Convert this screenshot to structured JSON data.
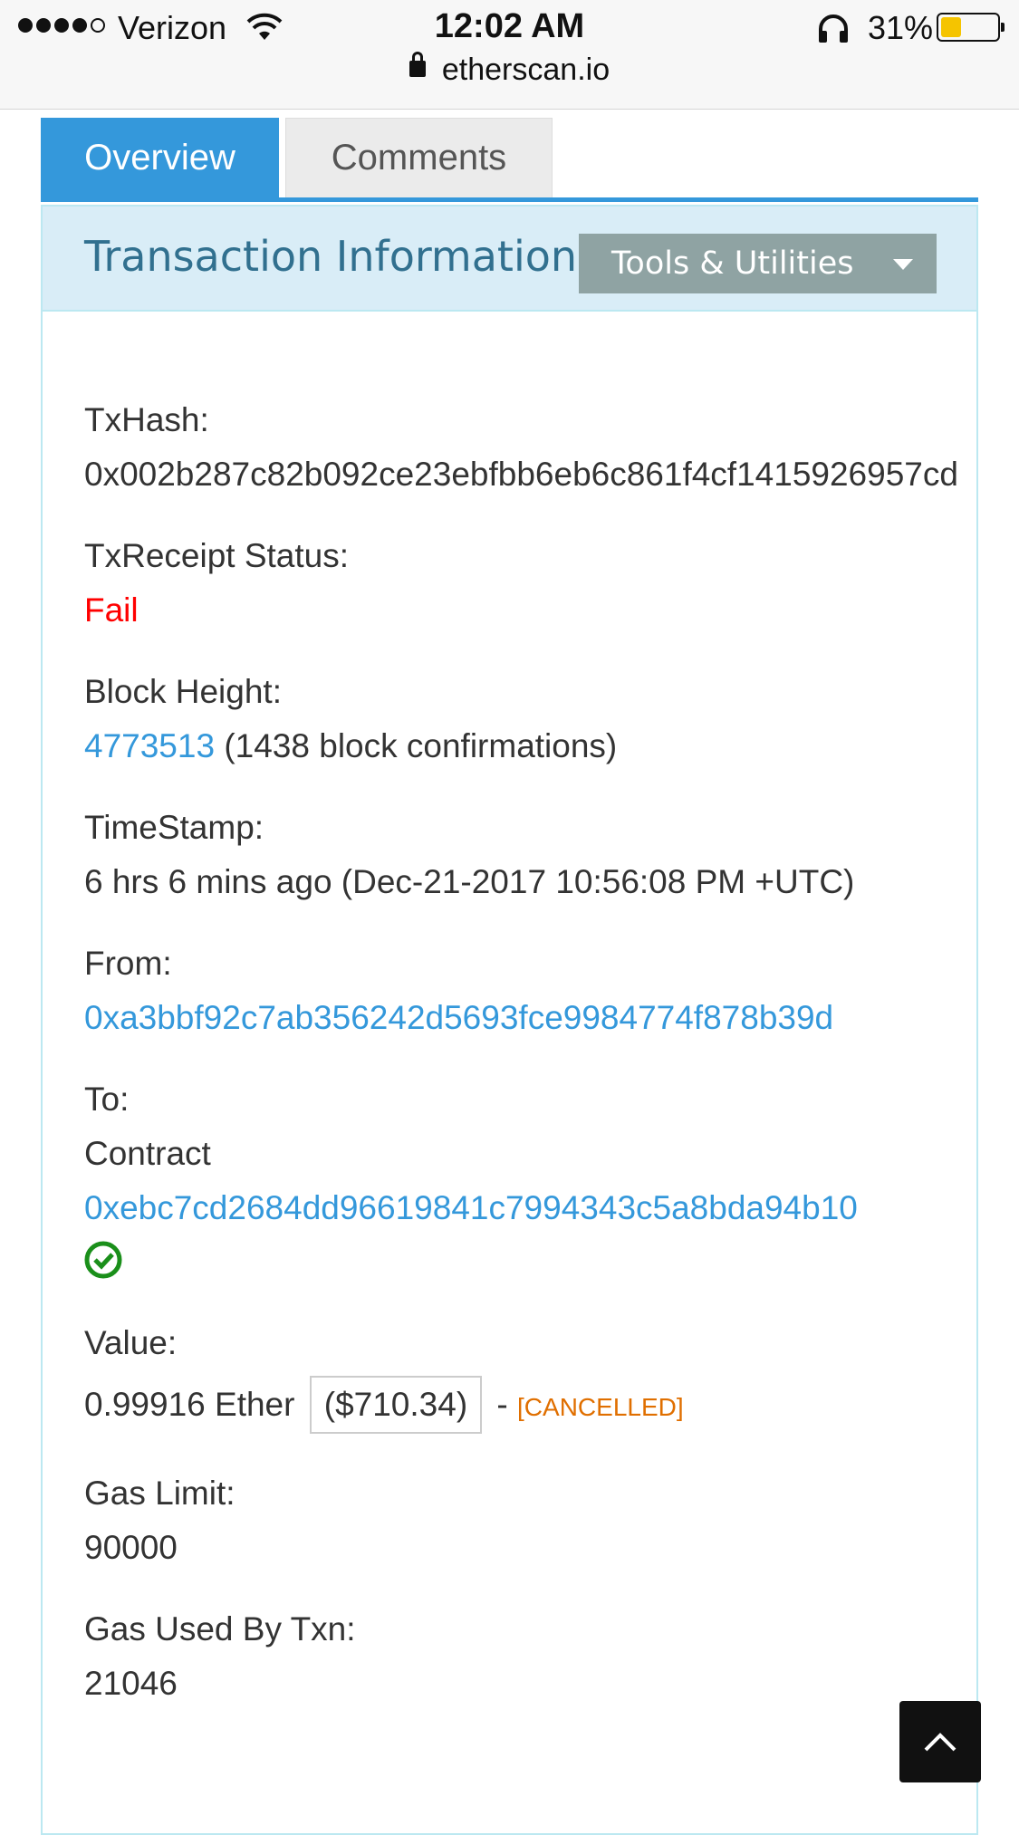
{
  "status_bar": {
    "carrier": "Verizon",
    "time": "12:02 AM",
    "battery_percent": "31%",
    "battery_level": 0.31
  },
  "browser": {
    "url": "etherscan.io"
  },
  "tabs": [
    {
      "label": "Overview",
      "active": true
    },
    {
      "label": "Comments",
      "active": false
    }
  ],
  "panel": {
    "title": "Transaction Information",
    "tools_label": "Tools & Utilities"
  },
  "fields": {
    "txhash": {
      "label": "TxHash:",
      "value": "0x002b287c82b092ce23ebfbb6eb6c861f4cf1415926957cd"
    },
    "status": {
      "label": "TxReceipt Status:",
      "value": "Fail"
    },
    "block": {
      "label": "Block Height:",
      "number": "4773513",
      "confirmations": "(1438 block confirmations)"
    },
    "timestamp": {
      "label": "TimeStamp:",
      "value": "6 hrs 6 mins ago (Dec-21-2017 10:56:08 PM +UTC)"
    },
    "from": {
      "label": "From:",
      "value": "0xa3bbf92c7ab356242d5693fce9984774f878b39d"
    },
    "to": {
      "label": "To:",
      "prefix": "Contract",
      "value": "0xebc7cd2684dd96619841c7994343c5a8bda94b10"
    },
    "value": {
      "label": "Value:",
      "ether": "0.99916 Ether",
      "usd": "($710.34)",
      "separator": "-",
      "note": "[CANCELLED]"
    },
    "gas_limit": {
      "label": "Gas Limit:",
      "value": "90000"
    },
    "gas_used": {
      "label": "Gas Used By Txn:",
      "value": "21046"
    }
  },
  "colors": {
    "accent": "#3498db",
    "fail": "#ff0000",
    "cancelled": "#e06f00",
    "verified": "#1a8f1a",
    "heading_bg": "#d9edf7",
    "heading_text": "#31708f"
  }
}
